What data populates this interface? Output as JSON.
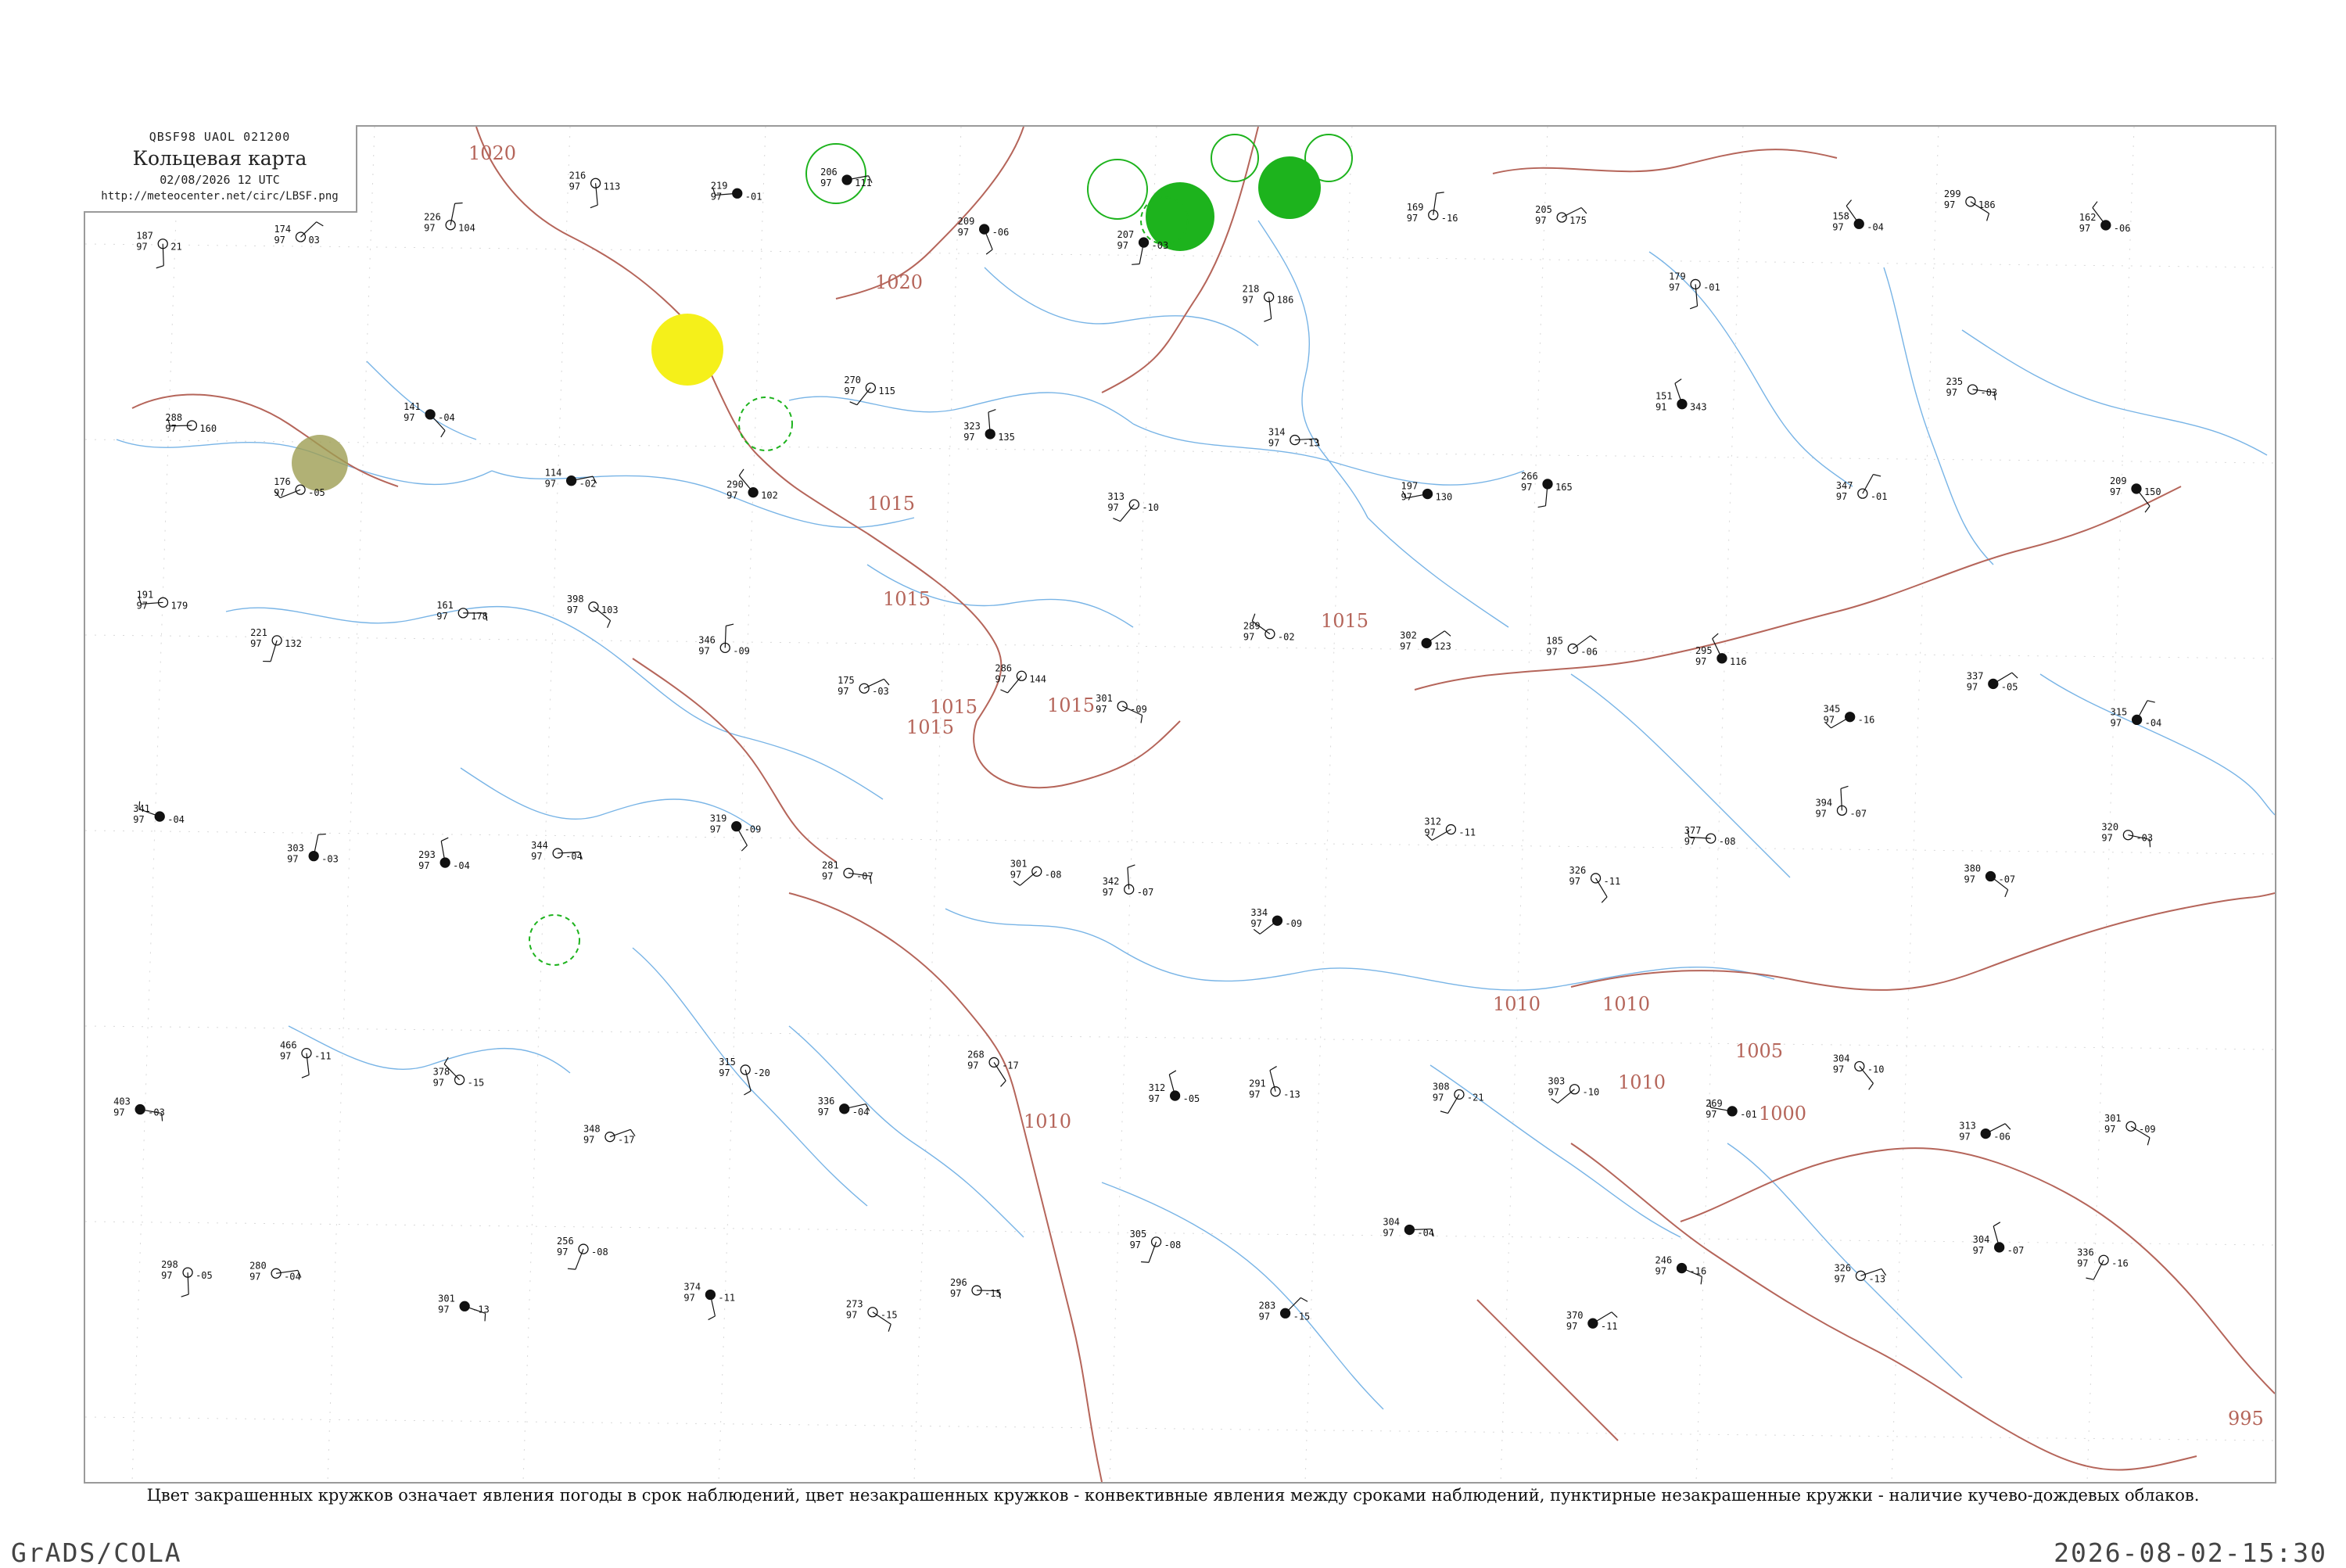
{
  "header": {
    "code": "QBSF98  UAOL  021200",
    "title": "Кольцевая карта",
    "datetime": "02/08/2026 12 UTC",
    "url": "http://meteocenter.net/circ/LBSF.png"
  },
  "caption": "Цвет закрашенных кружков означает явления погоды в срок наблюдений, цвет незакрашенных кружков - конвективные явления между сроками наблюдений, пунктирные незакрашенные кружки - наличие кучево-дождевых облаков.",
  "footer": {
    "brand": "GrADS/COLA",
    "timestamp": "2026-08-02-15:30"
  },
  "isobars": {
    "labels": [
      "1020",
      "1020",
      "1015",
      "1015",
      "1015",
      "1015",
      "1015",
      "1010",
      "1010",
      "1010",
      "1010",
      "1005",
      "1000",
      "995",
      "1015"
    ]
  },
  "colors": {
    "isobar": "#b5655a",
    "river": "#78b4e6",
    "station": "#111111",
    "thunder_green": "#1db31d",
    "fog_yellow": "#f5f01a",
    "haze_olive": "#9e9d52",
    "frame": "#9a9a9a"
  },
  "highlights": [
    {
      "kind": "fill",
      "color": "yellow"
    },
    {
      "kind": "fill",
      "color": "olive"
    },
    {
      "kind": "fill",
      "color": "green"
    },
    {
      "kind": "fill",
      "color": "green"
    },
    {
      "kind": "ring",
      "color": "green"
    },
    {
      "kind": "ring",
      "color": "green"
    },
    {
      "kind": "ring",
      "color": "green"
    },
    {
      "kind": "ring",
      "color": "green"
    },
    {
      "kind": "dashed-ring",
      "color": "green"
    },
    {
      "kind": "dashed-ring",
      "color": "green"
    },
    {
      "kind": "dashed-ring",
      "color": "green"
    }
  ],
  "stations": [
    {
      "t": "187",
      "p": "97",
      "v": "21"
    },
    {
      "t": "174",
      "p": "97",
      "v": "03"
    },
    {
      "t": "226",
      "p": "97",
      "v": "104"
    },
    {
      "t": "216",
      "p": "97",
      "v": "113"
    },
    {
      "t": "219",
      "p": "97",
      "v": "-01"
    },
    {
      "t": "206",
      "p": "97",
      "v": "111"
    },
    {
      "t": "209",
      "p": "97",
      "v": "-06"
    },
    {
      "t": "207",
      "p": "97",
      "v": "-03"
    },
    {
      "t": "218",
      "p": "97",
      "v": "186"
    },
    {
      "t": "169",
      "p": "97",
      "v": "-16"
    },
    {
      "t": "205",
      "p": "97",
      "v": "175"
    },
    {
      "t": "179",
      "p": "97",
      "v": "-01"
    },
    {
      "t": "158",
      "p": "97",
      "v": "-04"
    },
    {
      "t": "299",
      "p": "97",
      "v": "186"
    },
    {
      "t": "162",
      "p": "97",
      "v": "-06"
    },
    {
      "t": "288",
      "p": "97",
      "v": "160"
    },
    {
      "t": "176",
      "p": "97",
      "v": "-05"
    },
    {
      "t": "141",
      "p": "97",
      "v": "-04"
    },
    {
      "t": "114",
      "p": "97",
      "v": "-02"
    },
    {
      "t": "290",
      "p": "97",
      "v": "102"
    },
    {
      "t": "270",
      "p": "97",
      "v": "115"
    },
    {
      "t": "323",
      "p": "97",
      "v": "135"
    },
    {
      "t": "313",
      "p": "97",
      "v": "-10"
    },
    {
      "t": "314",
      "p": "97",
      "v": "-13"
    },
    {
      "t": "197",
      "p": "97",
      "v": "130"
    },
    {
      "t": "266",
      "p": "97",
      "v": "165"
    },
    {
      "t": "151",
      "p": "91",
      "v": "343"
    },
    {
      "t": "347",
      "p": "97",
      "v": "-01"
    },
    {
      "t": "235",
      "p": "97",
      "v": "-03"
    },
    {
      "t": "209",
      "p": "97",
      "v": "150"
    },
    {
      "t": "191",
      "p": "97",
      "v": "179"
    },
    {
      "t": "221",
      "p": "97",
      "v": "132"
    },
    {
      "t": "161",
      "p": "97",
      "v": "178"
    },
    {
      "t": "398",
      "p": "97",
      "v": "103"
    },
    {
      "t": "346",
      "p": "97",
      "v": "-09"
    },
    {
      "t": "175",
      "p": "97",
      "v": "-03"
    },
    {
      "t": "286",
      "p": "97",
      "v": "144"
    },
    {
      "t": "301",
      "p": "97",
      "v": "-09"
    },
    {
      "t": "289",
      "p": "97",
      "v": "-02"
    },
    {
      "t": "302",
      "p": "97",
      "v": "123"
    },
    {
      "t": "185",
      "p": "97",
      "v": "-06"
    },
    {
      "t": "295",
      "p": "97",
      "v": "116"
    },
    {
      "t": "345",
      "p": "97",
      "v": "-16"
    },
    {
      "t": "337",
      "p": "97",
      "v": "-05"
    },
    {
      "t": "315",
      "p": "97",
      "v": "-04"
    },
    {
      "t": "341",
      "p": "97",
      "v": "-04"
    },
    {
      "t": "303",
      "p": "97",
      "v": "-03"
    },
    {
      "t": "293",
      "p": "97",
      "v": "-04"
    },
    {
      "t": "344",
      "p": "97",
      "v": "-04"
    },
    {
      "t": "319",
      "p": "97",
      "v": "-09"
    },
    {
      "t": "281",
      "p": "97",
      "v": "-07"
    },
    {
      "t": "301",
      "p": "97",
      "v": "-08"
    },
    {
      "t": "342",
      "p": "97",
      "v": "-07"
    },
    {
      "t": "334",
      "p": "97",
      "v": "-09"
    },
    {
      "t": "312",
      "p": "97",
      "v": "-11"
    },
    {
      "t": "326",
      "p": "97",
      "v": "-11"
    },
    {
      "t": "377",
      "p": "97",
      "v": "-08"
    },
    {
      "t": "394",
      "p": "97",
      "v": "-07"
    },
    {
      "t": "380",
      "p": "97",
      "v": "-07"
    },
    {
      "t": "320",
      "p": "97",
      "v": "-03"
    },
    {
      "t": "403",
      "p": "97",
      "v": "-03"
    },
    {
      "t": "466",
      "p": "97",
      "v": "-11"
    },
    {
      "t": "378",
      "p": "97",
      "v": "-15"
    },
    {
      "t": "348",
      "p": "97",
      "v": "-17"
    },
    {
      "t": "315",
      "p": "97",
      "v": "-20"
    },
    {
      "t": "336",
      "p": "97",
      "v": "-04"
    },
    {
      "t": "268",
      "p": "97",
      "v": "-17"
    },
    {
      "t": "312",
      "p": "97",
      "v": "-05"
    },
    {
      "t": "291",
      "p": "97",
      "v": "-13"
    },
    {
      "t": "308",
      "p": "97",
      "v": "-21"
    },
    {
      "t": "303",
      "p": "97",
      "v": "-10"
    },
    {
      "t": "269",
      "p": "97",
      "v": "-01"
    },
    {
      "t": "304",
      "p": "97",
      "v": "-10"
    },
    {
      "t": "313",
      "p": "97",
      "v": "-06"
    },
    {
      "t": "301",
      "p": "97",
      "v": "-09"
    },
    {
      "t": "298",
      "p": "97",
      "v": "-05"
    },
    {
      "t": "280",
      "p": "97",
      "v": "-04"
    },
    {
      "t": "301",
      "p": "97",
      "v": "-13"
    },
    {
      "t": "256",
      "p": "97",
      "v": "-08"
    },
    {
      "t": "374",
      "p": "97",
      "v": "-11"
    },
    {
      "t": "273",
      "p": "97",
      "v": "-15"
    },
    {
      "t": "296",
      "p": "97",
      "v": "-15"
    },
    {
      "t": "305",
      "p": "97",
      "v": "-08"
    },
    {
      "t": "283",
      "p": "97",
      "v": "-15"
    },
    {
      "t": "304",
      "p": "97",
      "v": "-04"
    },
    {
      "t": "370",
      "p": "97",
      "v": "-11"
    },
    {
      "t": "246",
      "p": "97",
      "v": "-16"
    },
    {
      "t": "326",
      "p": "97",
      "v": "-13"
    },
    {
      "t": "304",
      "p": "97",
      "v": "-07"
    },
    {
      "t": "336",
      "p": "97",
      "v": "-16"
    }
  ]
}
